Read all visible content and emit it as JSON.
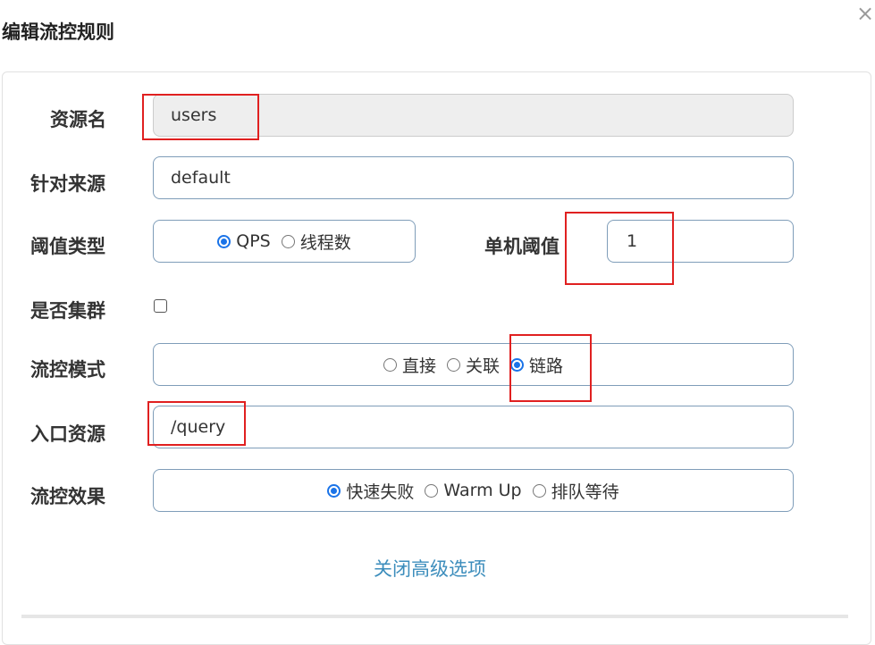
{
  "dialog": {
    "title": "编辑流控规则",
    "close_glyph": "×"
  },
  "form": {
    "resource": {
      "label": "资源名",
      "value": "users"
    },
    "limit_app": {
      "label": "针对来源",
      "value": "default"
    },
    "grade": {
      "label": "阈值类型",
      "options": [
        "QPS",
        "线程数"
      ],
      "selected": "QPS"
    },
    "count": {
      "label": "单机阈值",
      "value": "1"
    },
    "cluster": {
      "label": "是否集群",
      "checked": false
    },
    "strategy": {
      "label": "流控模式",
      "options": [
        "直接",
        "关联",
        "链路"
      ],
      "selected": "链路"
    },
    "ref_resource": {
      "label": "入口资源",
      "value": "/query"
    },
    "control_behavior": {
      "label": "流控效果",
      "options": [
        "快速失败",
        "Warm Up",
        "排队等待"
      ],
      "selected": "快速失败"
    }
  },
  "advanced_toggle": "关闭高级选项",
  "colors": {
    "accent": "#1a73e8",
    "link": "#3c8dbc",
    "highlight": "#e02020",
    "border": "#7f9db9"
  }
}
